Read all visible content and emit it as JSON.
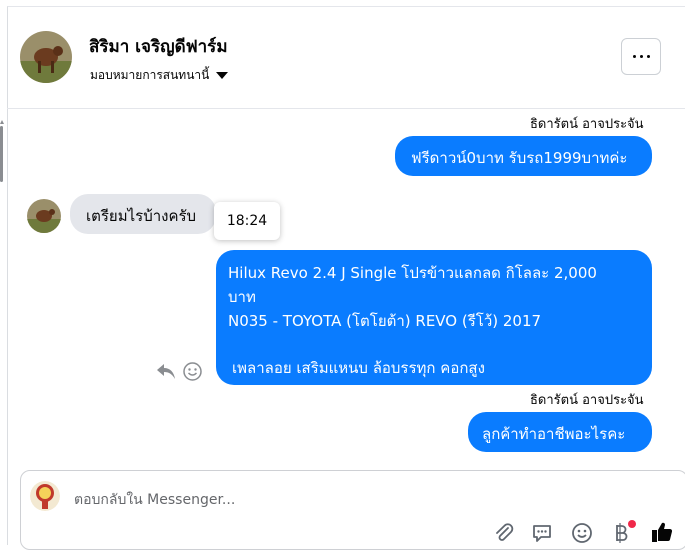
{
  "header": {
    "name": "สิริมา เจริญดีฟาร์ม",
    "subtitle": "มอบหมายการสนทนานี้"
  },
  "messages": [
    {
      "sender": "ธิดารัตน์ อาจประจัน",
      "text": "ฟรีดาวน์0บาท รับรถ1999บาทค่ะ"
    },
    {
      "text": "เตรียมไรบ้างครับ",
      "time": "18:24"
    },
    {
      "line1": "Hilux Revo 2.4 J Single โปรข้าวแลกลด กิโลละ 2,000",
      "line2": "บาท",
      "line3": "N035 - TOYOTA (โตโยต้า) REVO (รีโว้) 2017",
      "line4": "เพลาลอย เสริมแหนบ ล้อบรรทุก คอกสูง"
    },
    {
      "sender": "ธิดารัตน์ อาจประจัน",
      "text": "ลูกค้าทำอาชีพอะไรคะ"
    }
  ],
  "composer": {
    "placeholder": "ตอบกลับใน Messenger..."
  },
  "colors": {
    "accent": "#0a7cff",
    "incoming": "#e4e6eb",
    "badge": "#f02849"
  },
  "icons": [
    "more-icon",
    "caret-down-icon",
    "reply-icon",
    "emoji-react-icon",
    "attachment-icon",
    "saved-reply-icon",
    "emoji-icon",
    "payment-icon",
    "like-icon"
  ]
}
